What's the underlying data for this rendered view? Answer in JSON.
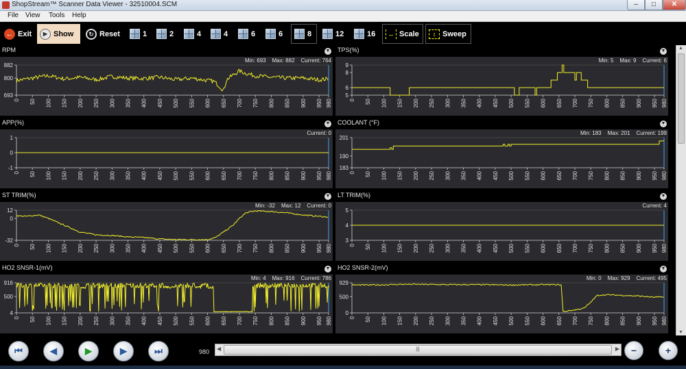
{
  "window": {
    "title": "ShopStream™ Scanner Data Viewer - 32510004.SCM",
    "controls": {
      "minimize": "–",
      "maximize": "□",
      "close": "✕"
    }
  },
  "menu": {
    "items": [
      "File",
      "View",
      "Tools",
      "Help"
    ]
  },
  "toolbar": {
    "exit_label": "Exit",
    "show_label": "Show",
    "reset_label": "Reset",
    "layouts": [
      "1",
      "2",
      "4",
      "4",
      "6",
      "6",
      "8",
      "12",
      "16"
    ],
    "selected_layout": "8",
    "scale_label": "Scale",
    "sweep_label": "Sweep"
  },
  "x_axis": {
    "ticks": [
      "0",
      "50",
      "100",
      "150",
      "200",
      "250",
      "300",
      "350",
      "400",
      "450",
      "500",
      "550",
      "600",
      "650",
      "700",
      "750",
      "800",
      "850",
      "900",
      "950",
      "980"
    ],
    "values": [
      0,
      50,
      100,
      150,
      200,
      250,
      300,
      350,
      400,
      450,
      500,
      550,
      600,
      650,
      700,
      750,
      800,
      850,
      900,
      950,
      980
    ],
    "range": [
      0,
      980
    ]
  },
  "trace_color": "#f2ef2c",
  "plot_bg": "#2b2b2f",
  "panes": [
    {
      "label": "RPM",
      "stats": {
        "min": "Min: 693",
        "max": "Max: 882",
        "current": "Current: 764"
      },
      "yticks": [
        "882",
        "800",
        "693"
      ],
      "ytick_values": [
        882,
        800,
        693
      ],
      "ylim": [
        693,
        882
      ],
      "chart_data": {
        "type": "line",
        "x": [
          0,
          50,
          100,
          150,
          200,
          250,
          300,
          350,
          400,
          450,
          500,
          550,
          600,
          620,
          640,
          650,
          660,
          680,
          700,
          720,
          750,
          800,
          850,
          900,
          950,
          980
        ],
        "y": [
          785,
          800,
          815,
          795,
          805,
          790,
          810,
          800,
          798,
          805,
          790,
          800,
          785,
          780,
          745,
          720,
          790,
          820,
          845,
          830,
          815,
          805,
          800,
          800,
          790,
          795
        ],
        "noise": "high"
      }
    },
    {
      "label": "TPS(%)",
      "stats": {
        "min": "Min: 5",
        "max": "Max: 9",
        "current": "Current: 6"
      },
      "yticks": [
        "9",
        "8",
        "6",
        "5"
      ],
      "ytick_values": [
        9,
        8,
        6,
        5
      ],
      "ylim": [
        5,
        9
      ],
      "chart_data": {
        "type": "step",
        "x": [
          0,
          115,
          120,
          175,
          180,
          505,
          510,
          525,
          530,
          560,
          565,
          575,
          580,
          620,
          625,
          640,
          645,
          660,
          665,
          680,
          700,
          705,
          720,
          740,
          980
        ],
        "y": [
          6,
          6,
          5,
          5,
          6,
          6,
          5,
          6,
          6,
          6,
          6,
          5,
          6,
          6,
          7,
          7,
          8,
          9,
          8,
          8,
          7,
          8,
          7,
          6,
          6
        ]
      }
    },
    {
      "label": "APP(%)",
      "stats": {
        "min": "",
        "max": "",
        "current": "Current: 0"
      },
      "yticks": [
        "1",
        "0",
        "-1"
      ],
      "ytick_values": [
        1,
        0,
        -1
      ],
      "ylim": [
        -1,
        1
      ],
      "chart_data": {
        "type": "step",
        "x": [
          0,
          980
        ],
        "y": [
          0,
          0
        ]
      }
    },
    {
      "label": "COOLANT (°F)",
      "stats": {
        "min": "Min: 183",
        "max": "Max: 201",
        "current": "Current: 199"
      },
      "yticks": [
        "201",
        "190",
        "183"
      ],
      "ytick_values": [
        201,
        190,
        183
      ],
      "ylim": [
        183,
        201
      ],
      "chart_data": {
        "type": "step",
        "x": [
          0,
          115,
          120,
          125,
          130,
          470,
          475,
          480,
          490,
          495,
          500,
          960,
          965,
          980
        ],
        "y": [
          194,
          194,
          195,
          194,
          196,
          196,
          197,
          196,
          197,
          196,
          197,
          197,
          199,
          199
        ]
      }
    },
    {
      "label": "ST TRIM(%)",
      "stats": {
        "min": "Min: -32",
        "max": "Max: 12",
        "current": "Current: 0"
      },
      "yticks": [
        "12",
        "0",
        "-32"
      ],
      "ytick_values": [
        12,
        0,
        -32
      ],
      "ylim": [
        -32,
        12
      ],
      "chart_data": {
        "type": "line",
        "x": [
          0,
          30,
          70,
          100,
          150,
          200,
          250,
          300,
          350,
          400,
          450,
          500,
          550,
          600,
          625,
          650,
          680,
          700,
          720,
          750,
          800,
          850,
          900,
          950,
          980
        ],
        "y": [
          4,
          3,
          5,
          0,
          -10,
          -20,
          -24,
          -25,
          -27,
          -28,
          -30,
          -31,
          -31,
          -31,
          -28,
          -20,
          -10,
          0,
          8,
          11,
          10,
          8,
          5,
          3,
          2
        ],
        "noise": "low"
      }
    },
    {
      "label": "LT TRIM(%)",
      "stats": {
        "min": "",
        "max": "",
        "current": "Current: 4"
      },
      "yticks": [
        "5",
        "4",
        "3"
      ],
      "ytick_values": [
        5,
        4,
        3
      ],
      "ylim": [
        3,
        5
      ],
      "chart_data": {
        "type": "step",
        "x": [
          0,
          980
        ],
        "y": [
          4,
          4
        ]
      }
    },
    {
      "label": "HO2 SNSR-1(mV)",
      "stats": {
        "min": "Min: 4",
        "max": "Max: 916",
        "current": "Current: 786"
      },
      "yticks": [
        "916",
        "500",
        "4"
      ],
      "ytick_values": [
        916,
        500,
        4
      ],
      "ylim": [
        4,
        916
      ],
      "chart_data": {
        "type": "o2",
        "bursts": [
          [
            0,
            200
          ],
          [
            220,
            300
          ],
          [
            305,
            340
          ],
          [
            325,
            460
          ],
          [
            500,
            560
          ],
          [
            580,
            600
          ],
          [
            745,
            980
          ]
        ],
        "flat": [
          [
            620,
            740
          ]
        ],
        "flat_level": 40,
        "final": 786
      }
    },
    {
      "label": "HO2 SNSR-2(mV)",
      "stats": {
        "min": "Min: 0",
        "max": "Max: 929",
        "current": "Current: 495"
      },
      "yticks": [
        "929",
        "500",
        "0"
      ],
      "ytick_values": [
        929,
        500,
        0
      ],
      "ylim": [
        0,
        929
      ],
      "chart_data": {
        "type": "line",
        "x": [
          0,
          50,
          100,
          150,
          200,
          300,
          400,
          500,
          600,
          650,
          658,
          662,
          700,
          730,
          750,
          770,
          800,
          850,
          900,
          950,
          980
        ],
        "y": [
          860,
          860,
          865,
          880,
          880,
          870,
          870,
          860,
          870,
          870,
          860,
          40,
          90,
          150,
          330,
          540,
          560,
          540,
          520,
          480,
          495
        ],
        "noise": "low"
      }
    }
  ],
  "navigation": {
    "buttons": {
      "first": "⏮",
      "prev": "◀",
      "play": "▶",
      "next": "▶",
      "last": "⏭"
    },
    "position": "980",
    "scroll_grip": "|||",
    "zoom_out": "−",
    "zoom_in": "+"
  }
}
